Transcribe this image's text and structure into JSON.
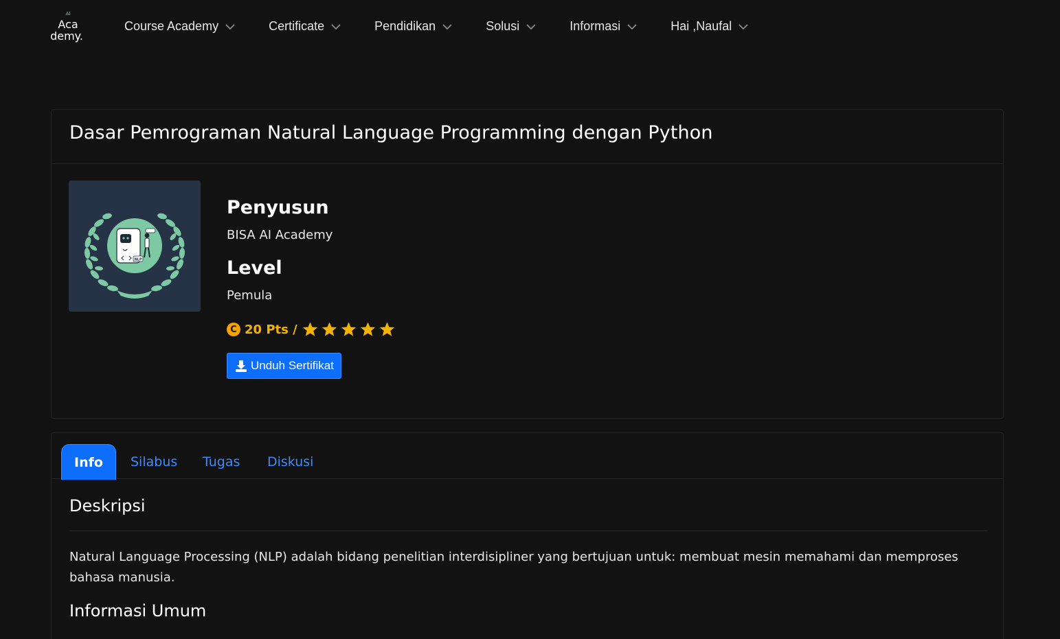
{
  "nav": {
    "logo_text_top": "Aca",
    "logo_text_bottom": "demy.",
    "logo_mark": "AI",
    "items": [
      {
        "label": "Course Academy"
      },
      {
        "label": "Certificate"
      },
      {
        "label": "Pendidikan"
      },
      {
        "label": "Solusi"
      },
      {
        "label": "Informasi"
      },
      {
        "label": "Hai ,Naufal"
      }
    ]
  },
  "course": {
    "title": "Dasar Pemrograman Natural Language Programming dengan Python",
    "thumbnail_icon": "laurel-badge-robot-icon",
    "thumbnail_badge": "NLP",
    "author_label": "Penyusun",
    "author_value": "BISA AI Academy",
    "level_label": "Level",
    "level_value": "Pemula",
    "points_text": "20 Pts /",
    "rating": 5,
    "rating_max": 5,
    "certificate_button": "Unduh Sertifikat"
  },
  "tabs": [
    {
      "label": "Info",
      "active": true
    },
    {
      "label": "Silabus",
      "active": false
    },
    {
      "label": "Tugas",
      "active": false
    },
    {
      "label": "Diskusi",
      "active": false
    }
  ],
  "info": {
    "desc_heading": "Deskripsi",
    "desc_text": "Natural Language Processing (NLP) adalah bidang penelitian interdisipliner yang bertujuan untuk: membuat mesin memahami dan memproses bahasa manusia.",
    "general_heading": "Informasi Umum"
  },
  "colors": {
    "background": "#121212",
    "primary": "#0d6efd",
    "link": "#3d8bfd",
    "gold": "#f5b301",
    "thumb_bg": "#263245",
    "thumb_green": "#7cc9a3"
  }
}
